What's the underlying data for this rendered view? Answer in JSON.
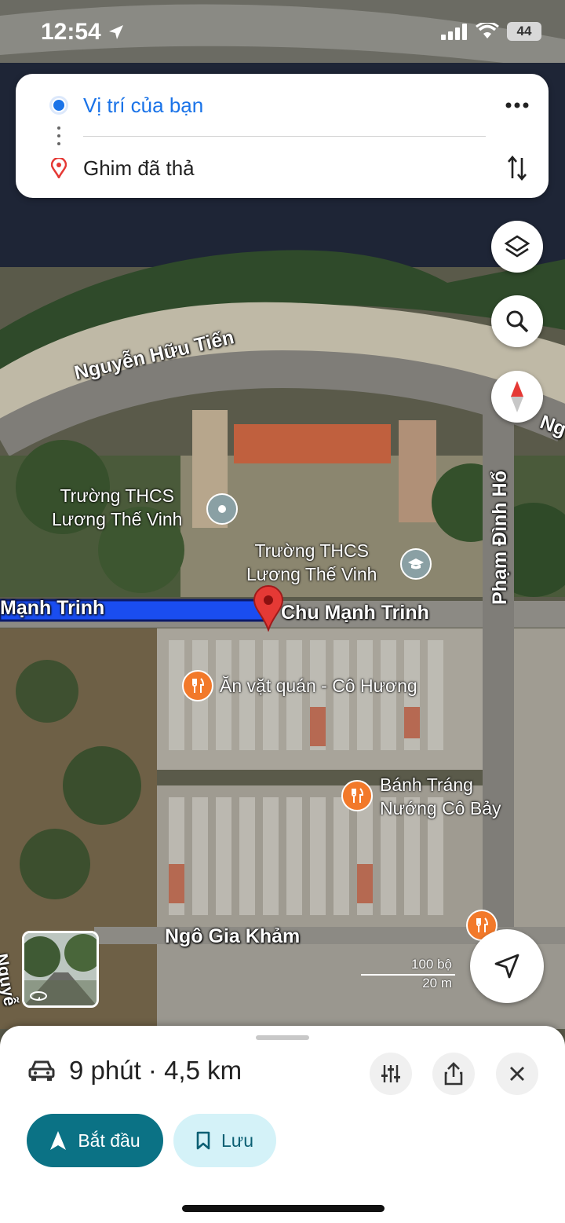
{
  "status_bar": {
    "time": "12:54",
    "battery": "44"
  },
  "route": {
    "origin": "Vị trí của bạn",
    "destination": "Ghim đã thả",
    "more_icon": "more-vert-icon",
    "swap_icon": "swap-icon"
  },
  "map": {
    "roads": {
      "nguyen_huu_tien": "Nguyễn Hữu Tiến",
      "chu_manh_trinh_left": "Mạnh Trinh",
      "chu_manh_trinh": "Chu Mạnh Trinh",
      "pham_dinh_ho": "Phạm Đình Hổ",
      "ngo_gia_kham": "Ngô Gia Khảm",
      "ng_right": "Ng",
      "nguyen_left": "Nguyễ"
    },
    "pois": [
      {
        "name": "Trường THCS\nLương Thế Vinh",
        "line1": "Trường THCS",
        "line2": "Lương Thế Vinh",
        "type": "place"
      },
      {
        "name": "Trường THCS Lương Thế Vinh",
        "line1": "Trường THCS",
        "line2": "Lương Thế Vinh",
        "type": "school"
      },
      {
        "name": "Ăn vặt quán - Cô Hương",
        "line1": "Ăn vặt quán - Cô Hương",
        "type": "food"
      },
      {
        "name": "Bánh Tráng Nướng Cô Bảy",
        "line1": "Bánh Tráng",
        "line2": "Nướng Cô Bảy",
        "type": "food"
      }
    ],
    "scale": {
      "imperial": "100 bộ",
      "metric": "20 m"
    },
    "route_color": "#1a4df0",
    "pin_color": "#e53935"
  },
  "trip": {
    "mode_icon": "car-icon",
    "summary": "9 phút · 4,5 km",
    "start_label": "Bắt đầu",
    "save_label": "Lưu"
  },
  "colors": {
    "accent": "#0b7285",
    "save_bg": "#d4f2f8",
    "link_blue": "#1a73e8"
  }
}
